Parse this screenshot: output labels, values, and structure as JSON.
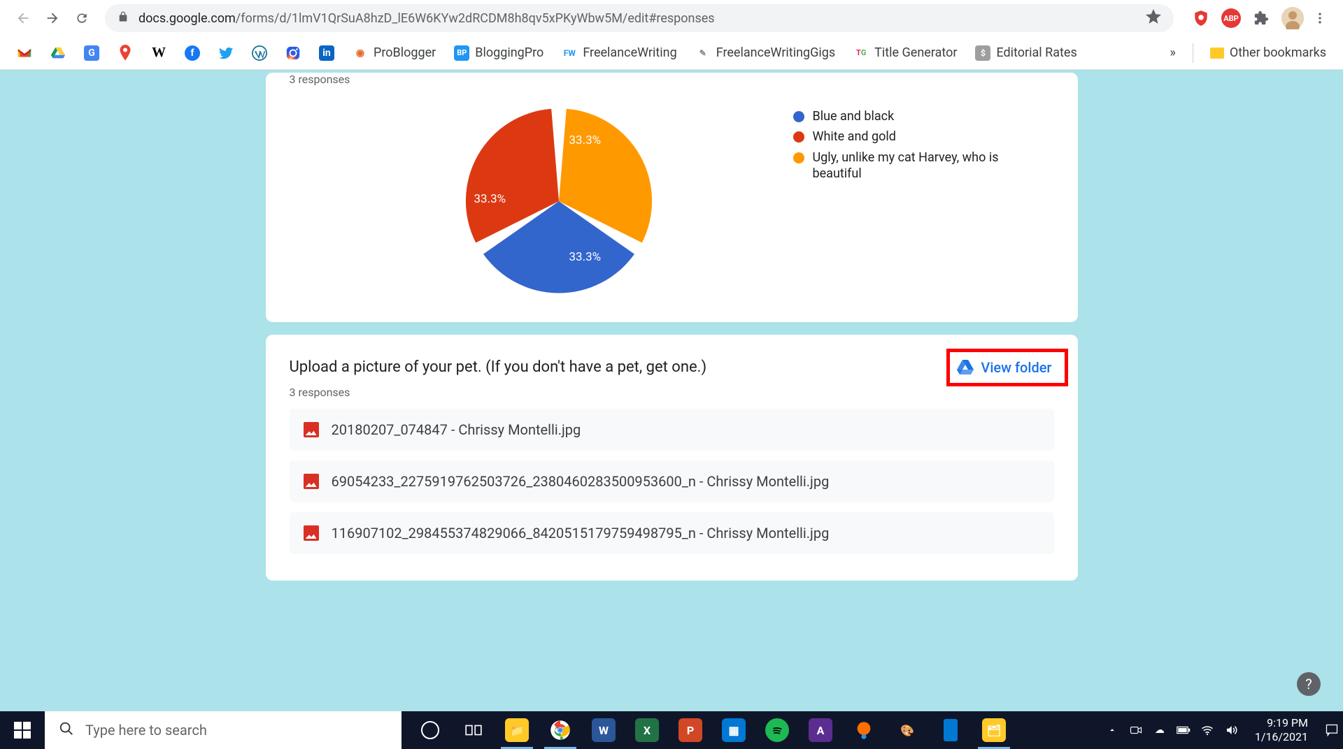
{
  "browser": {
    "url_host": "docs.google.com",
    "url_path": "/forms/d/1lmV1QrSuA8hzD_lE6W6KYw2dRCDM8h8qv5xPKyWbw5M/edit#responses"
  },
  "bookmarks": [
    {
      "label": "",
      "icon": "gmail"
    },
    {
      "label": "",
      "icon": "drive"
    },
    {
      "label": "",
      "icon": "translate"
    },
    {
      "label": "",
      "icon": "maps"
    },
    {
      "label": "",
      "icon": "wikipedia"
    },
    {
      "label": "",
      "icon": "facebook"
    },
    {
      "label": "",
      "icon": "twitter"
    },
    {
      "label": "",
      "icon": "wordpress"
    },
    {
      "label": "",
      "icon": "instagram"
    },
    {
      "label": "",
      "icon": "linkedin"
    },
    {
      "label": "ProBlogger",
      "icon": "problogger"
    },
    {
      "label": "BloggingPro",
      "icon": "bp"
    },
    {
      "label": "FreelanceWriting",
      "icon": "fw"
    },
    {
      "label": "FreelanceWritingGigs",
      "icon": "fwg"
    },
    {
      "label": "Title Generator",
      "icon": "tg"
    },
    {
      "label": "Editorial Rates",
      "icon": "er"
    }
  ],
  "bookmarks_more": "»",
  "other_bookmarks": "Other bookmarks",
  "card_pie": {
    "responses": "3 responses",
    "legend": [
      {
        "label": "Blue and black",
        "color": "#3366cc"
      },
      {
        "label": "White and gold",
        "color": "#dc3912"
      },
      {
        "label": "Ugly, unlike my cat Harvey, who is beautiful",
        "color": "#ff9900"
      }
    ]
  },
  "chart_data": {
    "type": "pie",
    "title": "",
    "categories": [
      "Blue and black",
      "White and gold",
      "Ugly, unlike my cat Harvey, who is beautiful"
    ],
    "values": [
      33.3,
      33.3,
      33.3
    ],
    "colors": [
      "#3366cc",
      "#dc3912",
      "#ff9900"
    ],
    "slice_labels": [
      "33.3%",
      "33.3%",
      "33.3%"
    ]
  },
  "card_upload": {
    "title": "Upload a picture of your pet. (If you don't have a pet, get one.)",
    "responses": "3 responses",
    "view_folder": "View folder",
    "files": [
      "20180207_074847 - Chrissy Montelli.jpg",
      "69054233_2275919762503726_2380460283500953600_n - Chrissy Montelli.jpg",
      "116907102_298455374829066_8420515179759498795_n - Chrissy Montelli.jpg"
    ]
  },
  "taskbar": {
    "search_placeholder": "Type here to search",
    "time": "9:19 PM",
    "date": "1/16/2021"
  }
}
